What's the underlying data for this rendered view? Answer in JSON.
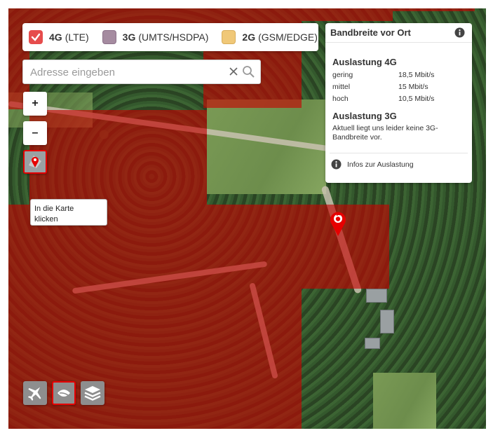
{
  "legend": {
    "items": [
      {
        "tech": "4G",
        "detail": "(LTE)",
        "color": "#e64c4c",
        "checked": true
      },
      {
        "tech": "3G",
        "detail": "(UMTS/HSDPA)",
        "color": "#a58ba0",
        "checked": false
      },
      {
        "tech": "2G",
        "detail": "(GSM/EDGE)",
        "color": "#f0c878",
        "checked": false
      }
    ]
  },
  "search": {
    "placeholder": "Adresse eingeben",
    "value": ""
  },
  "zoom": {
    "in_label": "+",
    "out_label": "–"
  },
  "tooltip": {
    "line1": "In die Karte",
    "line2": "klicken"
  },
  "panel": {
    "title": "Bandbreite vor Ort",
    "section_4g": "Auslastung 4G",
    "rows_4g": [
      {
        "label": "gering",
        "value": "18,5 Mbit/s"
      },
      {
        "label": "mittel",
        "value": "15 Mbit/s"
      },
      {
        "label": "hoch",
        "value": "10,5 Mbit/s"
      }
    ],
    "section_3g": "Auslastung 3G",
    "note_3g": "Aktuell liegt uns leider keine 3G-Bandbreite vor.",
    "footer_link": "Infos zur Auslastung"
  },
  "icons": {
    "legend_check": "check-icon",
    "search": "search-icon",
    "clear": "close-icon",
    "locate": "location-pin-icon",
    "marker": "vodafone-marker-icon",
    "info": "info-icon",
    "airplane": "airplane-icon",
    "leaf": "leaf-icon",
    "layers": "layers-icon"
  },
  "colors": {
    "coverage_4g": "#c80000",
    "brand": "#e60000"
  }
}
